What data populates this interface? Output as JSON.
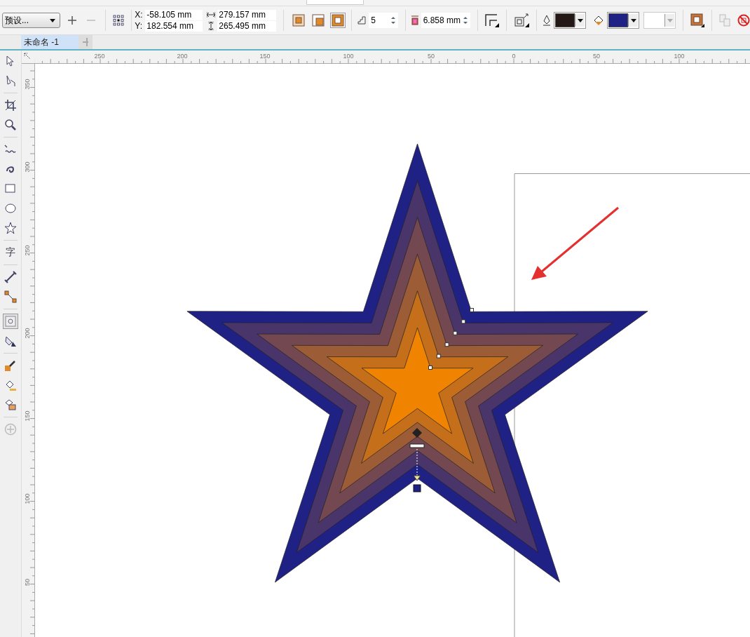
{
  "property_bar": {
    "preset": "预设...",
    "x_label": "X:",
    "x_value": "-58.105 mm",
    "y_label": "Y:",
    "y_value": "182.554 mm",
    "width_value": "279.157 mm",
    "height_value": "265.495 mm",
    "directions": [
      {
        "kind": "center",
        "selected": false
      },
      {
        "kind": "inside",
        "selected": false
      },
      {
        "kind": "outside",
        "selected": true
      }
    ],
    "steps": "5",
    "offset": "6.858 mm",
    "color_pickers": [
      {
        "kind": "outline",
        "color": "#231815"
      },
      {
        "kind": "fill",
        "color": "#1f2185"
      }
    ]
  },
  "tabs": [
    {
      "label": "未命名 -1",
      "selected": true
    }
  ],
  "horizontal_ruler": [
    "250",
    "200",
    "150",
    "100",
    "50",
    "0",
    "50",
    "100"
  ],
  "vertical_ruler": [
    "350",
    "300",
    "250",
    "200",
    "150",
    "100",
    "50"
  ],
  "tools": [
    {
      "kind": "pick",
      "selected": false
    },
    {
      "kind": "shape",
      "selected": false
    },
    {
      "kind": "crop",
      "selected": false
    },
    {
      "kind": "zoom",
      "selected": false
    },
    {
      "kind": "freehand",
      "selected": false
    },
    {
      "kind": "artistic",
      "selected": false
    },
    {
      "kind": "rectangle",
      "selected": false
    },
    {
      "kind": "ellipse",
      "selected": false
    },
    {
      "kind": "star",
      "selected": false
    },
    {
      "kind": "text",
      "label": "字",
      "selected": false
    },
    {
      "kind": "dimension",
      "selected": false
    },
    {
      "kind": "connector",
      "selected": false
    },
    {
      "kind": "contour",
      "selected": true
    },
    {
      "kind": "fill",
      "selected": false
    },
    {
      "kind": "eyedropper",
      "selected": false
    },
    {
      "kind": "smartfill",
      "selected": false
    },
    {
      "kind": "outline",
      "selected": false
    },
    {
      "kind": "add",
      "selected": false
    }
  ]
}
